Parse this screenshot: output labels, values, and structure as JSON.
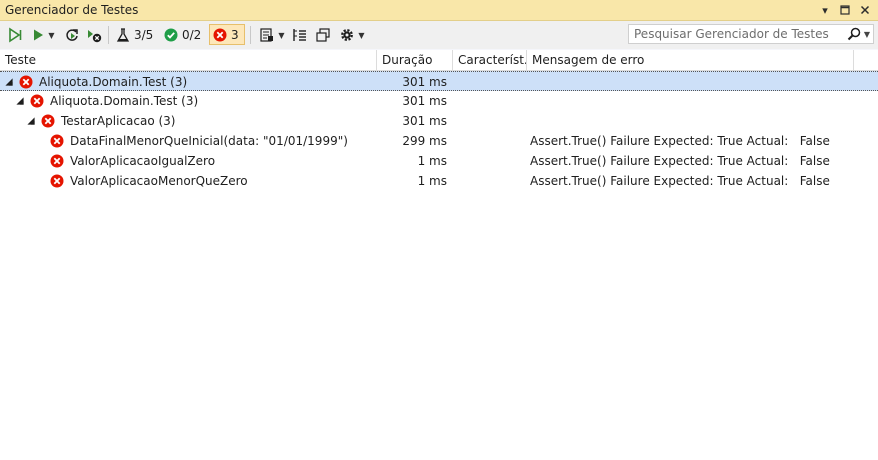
{
  "window": {
    "title": "Gerenciador de Testes",
    "controls": [
      "dropdown",
      "restore",
      "close"
    ]
  },
  "toolbar": {
    "run_all_icon": "run-all-icon",
    "run_icon": "run-icon",
    "repeat_icon": "repeat-last-run-icon",
    "cancel_icon": "cancel-icon",
    "total_label": "3/5",
    "passed_label": "0/2",
    "failed_label": "3",
    "playlist_icon": "playlist-icon",
    "group_icon": "group-by-icon",
    "columns_icon": "columns-icon",
    "settings_icon": "gear-icon"
  },
  "search": {
    "placeholder": "Pesquisar Gerenciador de Testes"
  },
  "columns": {
    "test": "Teste",
    "duration": "Duração",
    "traits": "Característ...",
    "message": "Mensagem de erro"
  },
  "rows": [
    {
      "level": 0,
      "name": "Aliquota.Domain.Test  (3)",
      "duration": "301 ms",
      "message": "",
      "selected": true,
      "expandable": true
    },
    {
      "level": 1,
      "name": "Aliquota.Domain.Test  (3)",
      "duration": "301 ms",
      "message": "",
      "selected": false,
      "expandable": true
    },
    {
      "level": 2,
      "name": "TestarAplicacao  (3)",
      "duration": "301 ms",
      "message": "",
      "selected": false,
      "expandable": true
    },
    {
      "level": 3,
      "name": "DataFinalMenorQueInicial(data: \"01/01/1999\")",
      "duration": "299 ms",
      "message": "Assert.True() Failure Expected: True Actual:   False",
      "selected": false,
      "expandable": false
    },
    {
      "level": 3,
      "name": "ValorAplicacaoIgualZero",
      "duration": "1 ms",
      "message": "Assert.True() Failure Expected: True Actual:   False",
      "selected": false,
      "expandable": false
    },
    {
      "level": 3,
      "name": "ValorAplicacaoMenorQueZero",
      "duration": "1 ms",
      "message": "Assert.True() Failure Expected: True Actual:   False",
      "selected": false,
      "expandable": false
    }
  ],
  "colors": {
    "titlebar": "#f9e7a9",
    "selection": "#cde0f8",
    "fail": "#e51400",
    "pass": "#1f9e48",
    "run": "#388a34"
  }
}
